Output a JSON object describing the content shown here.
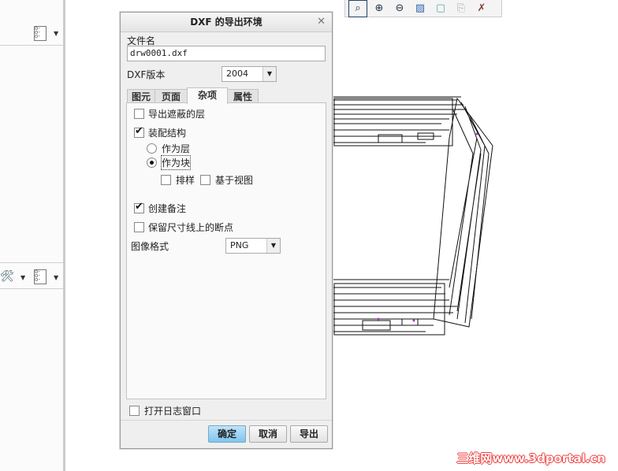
{
  "dialog": {
    "title": "DXF 的导出环境",
    "close": "✕",
    "file_name_label": "文件名",
    "file_name": "drw0001.dxf",
    "version_label": "DXF版本",
    "version": "2004",
    "tabs": [
      {
        "label": "图元"
      },
      {
        "label": "页面"
      },
      {
        "label": "杂项"
      },
      {
        "label": "属性"
      }
    ],
    "options": {
      "export_hidden_layers": "导出遮蔽的层",
      "assembly_structure": "装配结构",
      "as_layer": "作为层",
      "as_block": "作为块",
      "sort": "排样",
      "view_based": "基于视图",
      "create_notes": "创建备注",
      "keep_breaks": "保留尺寸线上的断点",
      "image_format_label": "图像格式",
      "image_format": "PNG"
    },
    "open_log": "打开日志窗口",
    "ok": "确定",
    "cancel": "取消",
    "export": "导出"
  },
  "watermark": "三维网www.3dportal.cn"
}
